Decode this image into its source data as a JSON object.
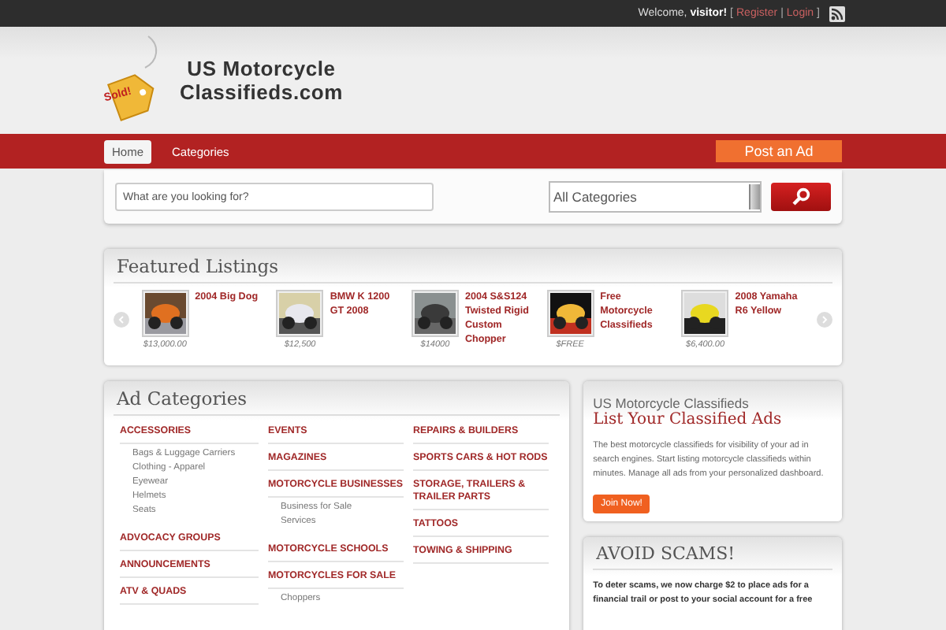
{
  "top_bar": {
    "welcome": "Welcome, **visitor!**",
    "open_bracket": "[",
    "links": [
      "Register",
      "Login"
    ],
    "separator": "|",
    "close_bracket": "]"
  },
  "logo": {
    "badge": "Sold!",
    "title_line_1": "US Motorcycle",
    "title_line_2": "Classifieds.com"
  },
  "nav": {
    "items": [
      {
        "label": "Home",
        "selected": true
      },
      {
        "label": "Categories",
        "selected": false
      }
    ],
    "post_button": "Post an Ad"
  },
  "search": {
    "placeholder": "What are you looking for?",
    "category": "All Categories"
  },
  "featured": {
    "title": "Featured Listings",
    "items": [
      {
        "title": "2004 Big Dog",
        "price": "$13,000.00"
      },
      {
        "title": "BMW K 1200 GT 2008",
        "price": "$12,500"
      },
      {
        "title": "2004 S&S124 Twisted Rigid Custom Chopper",
        "price": "$14000"
      },
      {
        "title": "Free Motorcycle Classifieds",
        "price": "$FREE"
      },
      {
        "title": "2008 Yamaha R6 Yellow",
        "price": "$6,400.00"
      }
    ]
  },
  "ad_categories": {
    "title": "Ad Categories",
    "columns": [
      [
        {
          "name": "ACCESSORIES",
          "children": [
            "Bags & Luggage Carriers",
            "Clothing - Apparel",
            "Eyewear",
            "Helmets",
            "Seats"
          ]
        },
        {
          "name": "ADVOCACY GROUPS"
        },
        {
          "name": "ANNOUNCEMENTS"
        },
        {
          "name": "ATV & QUADS"
        }
      ],
      [
        {
          "name": "EVENTS"
        },
        {
          "name": "MAGAZINES"
        },
        {
          "name": "MOTORCYCLE BUSINESSES",
          "children": [
            "Business for Sale",
            "Services"
          ]
        },
        {
          "name": "MOTORCYCLE SCHOOLS"
        },
        {
          "name": "MOTORCYCLES FOR SALE",
          "children": [
            "Choppers"
          ]
        }
      ],
      [
        {
          "name": "REPAIRS & BUILDERS"
        },
        {
          "name": "SPORTS CARS & HOT RODS"
        },
        {
          "name": "STORAGE, TRAILERS & TRAILER PARTS"
        },
        {
          "name": "TATTOOS"
        },
        {
          "name": "TOWING & SHIPPING"
        }
      ]
    ]
  },
  "promo": {
    "subtitle": "US Motorcycle Classifieds",
    "title": "List Your Classified Ads",
    "text": "The best motorcycle classifieds for visibility of your ad in search engines. Start listing motorcycle classifieds within minutes. Manage all ads from your personalized dashboard.",
    "button": "Join Now!"
  },
  "scams": {
    "title": "AVOID SCAMS!",
    "text": "To deter scams, we now charge $2 to place ads for a financial trail or post to your social account for a free"
  }
}
